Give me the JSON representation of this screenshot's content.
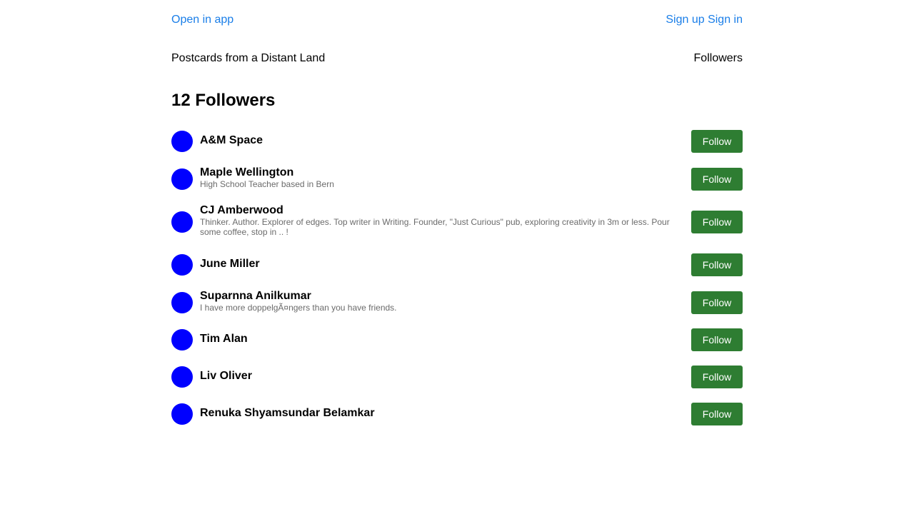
{
  "topbar": {
    "open_in_app": "Open in app",
    "auth": "Sign up Sign in"
  },
  "subbar": {
    "publication": "Postcards from a Distant Land",
    "section": "Followers"
  },
  "heading": "12 Followers",
  "colors": {
    "link": "#1a7ee8",
    "follow_button": "#2e7d32",
    "avatar": "#0000ff"
  },
  "followers": [
    {
      "name": "A&M Space",
      "bio": "",
      "button": "Follow"
    },
    {
      "name": "Maple Wellington",
      "bio": "High School Teacher based in Bern",
      "button": "Follow"
    },
    {
      "name": "CJ Amberwood",
      "bio": "Thinker. Author. Explorer of edges. Top writer in Writing. Founder, \"Just Curious\" pub, exploring creativity in 3m or less. Pour some coffee, stop in .. !",
      "button": "Follow"
    },
    {
      "name": "June Miller",
      "bio": "",
      "button": "Follow"
    },
    {
      "name": "Suparnna Anilkumar",
      "bio": "I have more doppelgÃ¤ngers than you have friends.",
      "button": "Follow"
    },
    {
      "name": "Tim Alan",
      "bio": "",
      "button": "Follow"
    },
    {
      "name": "Liv Oliver",
      "bio": "",
      "button": "Follow"
    },
    {
      "name": "Renuka Shyamsundar Belamkar",
      "bio": "",
      "button": "Follow"
    }
  ]
}
